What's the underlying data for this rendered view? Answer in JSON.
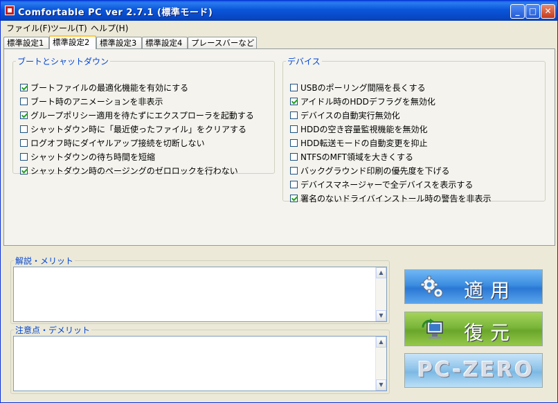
{
  "window": {
    "title": "Comfortable PC ver 2.7.1 (標準モード)"
  },
  "controls": {
    "minimize": "_",
    "maximize": "□",
    "close": "✕"
  },
  "menu": [
    "ファイル(F)",
    "ツール(T)",
    "ヘルプ(H)"
  ],
  "tabs": [
    {
      "label": "標準設定1",
      "active": false
    },
    {
      "label": "標準設定2",
      "active": true
    },
    {
      "label": "標準設定3",
      "active": false
    },
    {
      "label": "標準設定4",
      "active": false
    },
    {
      "label": "プレースバーなど",
      "active": false
    }
  ],
  "boot_group": {
    "title": "ブートとシャットダウン",
    "items": [
      {
        "label": "ブートファイルの最適化機能を有効にする",
        "checked": true
      },
      {
        "label": "ブート時のアニメーションを非表示",
        "checked": false
      },
      {
        "label": "グループポリシー適用を待たずにエクスプローラを起動する",
        "checked": true
      },
      {
        "label": "シャットダウン時に「最近使ったファイル」をクリアする",
        "checked": false
      },
      {
        "label": "ログオフ時にダイヤルアップ接続を切断しない",
        "checked": false
      },
      {
        "label": "シャットダウンの待ち時間を短縮",
        "checked": false
      },
      {
        "label": "シャットダウン時のページングのゼロロックを行わない",
        "checked": true
      }
    ]
  },
  "device_group": {
    "title": "デバイス",
    "items": [
      {
        "label": "USBのポーリング間隔を長くする",
        "checked": false
      },
      {
        "label": "アイドル時のHDDデフラグを無効化",
        "checked": true
      },
      {
        "label": "デバイスの自動実行無効化",
        "checked": false
      },
      {
        "label": "HDDの空き容量監視機能を無効化",
        "checked": false
      },
      {
        "label": "HDD転送モードの自動変更を抑止",
        "checked": false
      },
      {
        "label": "NTFSのMFT領域を大きくする",
        "checked": false
      },
      {
        "label": "バックグラウンド印刷の優先度を下げる",
        "checked": false
      },
      {
        "label": "デバイスマネージャーで全デバイスを表示する",
        "checked": false
      },
      {
        "label": "署名のないドライバインストール時の警告を非表示",
        "checked": true
      }
    ]
  },
  "merit": {
    "title": "解説・メリット",
    "text": ""
  },
  "demerit": {
    "title": "注意点・デメリット",
    "text": ""
  },
  "buttons": {
    "apply": "適用",
    "restore": "復元",
    "zero": "PC-ZERO"
  },
  "icons": {
    "apply": "gear-icon",
    "restore": "restore-monitor-icon"
  },
  "colors": {
    "group_title": "#0046d5",
    "apply": "#3c8de0",
    "restore": "#7ab63a"
  }
}
